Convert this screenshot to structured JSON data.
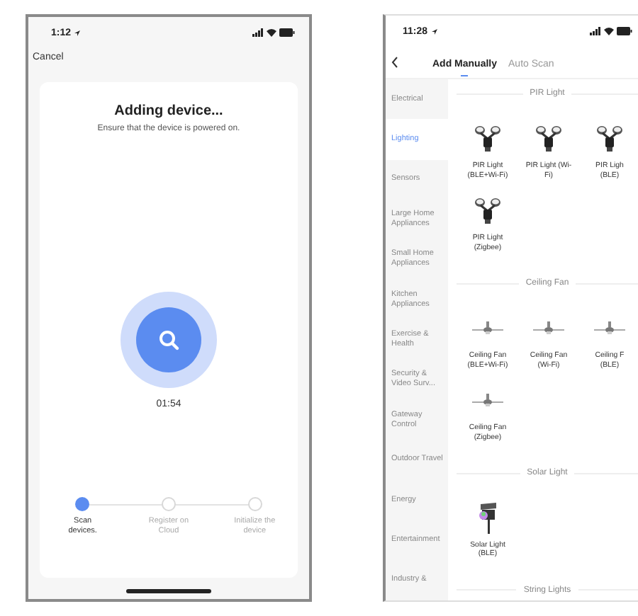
{
  "left_phone": {
    "status_bar": {
      "time": "1:12"
    },
    "cancel": "Cancel",
    "title": "Adding device...",
    "subtitle": "Ensure that the device is powered on.",
    "timer": "01:54",
    "steps": [
      {
        "label": "Scan devices.",
        "active": true
      },
      {
        "label": "Register on Cloud",
        "active": false
      },
      {
        "label": "Initialize the device",
        "active": false
      }
    ]
  },
  "right_phone": {
    "status_bar": {
      "time": "11:28"
    },
    "tabs": [
      {
        "label": "Add Manually",
        "selected": true
      },
      {
        "label": "Auto Scan",
        "selected": false
      }
    ],
    "categories": [
      {
        "label": "Electrical",
        "selected": false
      },
      {
        "label": "Lighting",
        "selected": true
      },
      {
        "label": "Sensors",
        "selected": false
      },
      {
        "label": "Large Home Appliances",
        "selected": false
      },
      {
        "label": "Small Home Appliances",
        "selected": false
      },
      {
        "label": "Kitchen Appliances",
        "selected": false
      },
      {
        "label": "Exercise & Health",
        "selected": false
      },
      {
        "label": "Security & Video Surv...",
        "selected": false
      },
      {
        "label": "Gateway Control",
        "selected": false
      },
      {
        "label": "Outdoor Travel",
        "selected": false
      },
      {
        "label": "Energy",
        "selected": false
      },
      {
        "label": "Entertainment",
        "selected": false
      },
      {
        "label": "Industry &",
        "selected": false
      }
    ],
    "sections": [
      {
        "title": "PIR Light",
        "devices": [
          {
            "name": "PIR Light (BLE+Wi-Fi)",
            "kind": "floodlight"
          },
          {
            "name": "PIR Light (Wi-Fi)",
            "kind": "floodlight"
          },
          {
            "name": "PIR Ligh (BLE)",
            "kind": "floodlight"
          },
          {
            "name": "PIR Light (Zigbee)",
            "kind": "floodlight"
          }
        ]
      },
      {
        "title": "Ceiling Fan",
        "devices": [
          {
            "name": "Ceiling Fan (BLE+Wi-Fi)",
            "kind": "fan"
          },
          {
            "name": "Ceiling Fan (Wi-Fi)",
            "kind": "fan"
          },
          {
            "name": "Ceiling F (BLE)",
            "kind": "fan"
          },
          {
            "name": "Ceiling Fan (Zigbee)",
            "kind": "fan"
          }
        ]
      },
      {
        "title": "Solar Light",
        "devices": [
          {
            "name": "Solar Light (BLE)",
            "kind": "solar"
          }
        ]
      },
      {
        "title": "String Lights"
      }
    ]
  }
}
